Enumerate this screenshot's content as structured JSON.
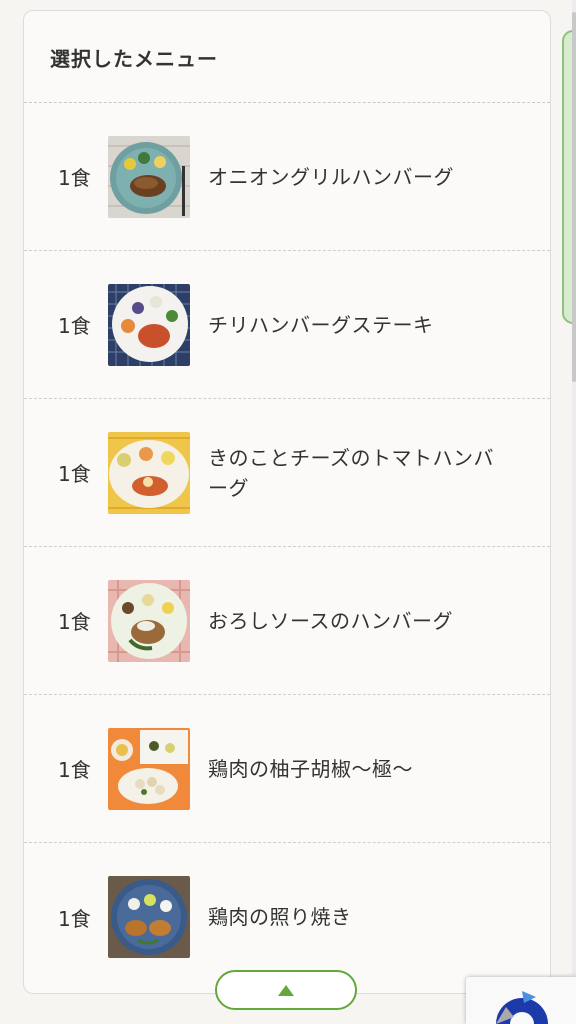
{
  "panel": {
    "title": "選択したメニュー"
  },
  "menu_items": [
    {
      "quantity": "1食",
      "name": "オニオングリルハンバーグ",
      "image": "onion-grill-hamburg-photo"
    },
    {
      "quantity": "1食",
      "name": "チリハンバーグステーキ",
      "image": "chili-hamburg-steak-photo"
    },
    {
      "quantity": "1食",
      "name": "きのことチーズのトマトハンバーグ",
      "image": "mushroom-cheese-tomato-hamburg-photo"
    },
    {
      "quantity": "1食",
      "name": "おろしソースのハンバーグ",
      "image": "grated-radish-sauce-hamburg-photo"
    },
    {
      "quantity": "1食",
      "name": "鶏肉の柚子胡椒～極～",
      "image": "chicken-yuzu-pepper-photo"
    },
    {
      "quantity": "1食",
      "name": "鶏肉の照り焼き",
      "image": "chicken-teriyaki-photo"
    }
  ],
  "scroll_top_button": {
    "icon": "triangle-up-icon",
    "color": "#63a83a"
  },
  "recaptcha": {
    "icon": "recaptcha-icon"
  }
}
